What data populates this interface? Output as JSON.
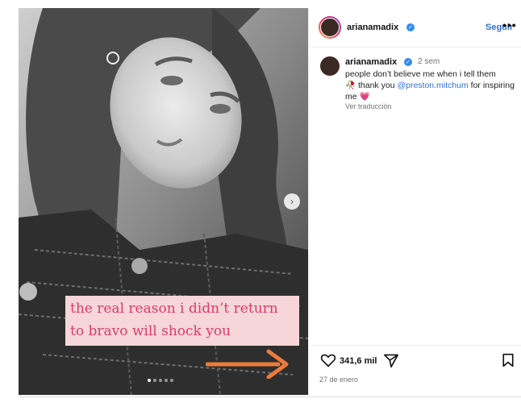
{
  "post": {
    "image": {
      "caption_line1": "the real reason i didn’t return",
      "caption_line2": "to bravo will shock you",
      "caption_color": "#d93b6c",
      "caption_bg": "#f6d6d8",
      "arrow_color": "#ee7a3a",
      "slide_count": 5,
      "active_slide": 1
    },
    "header": {
      "username": "arianamadix",
      "follow_label": "Seguir",
      "more_label": "•••"
    },
    "comment": {
      "username": "arianamadix",
      "time": "2 sem",
      "text_before": "people don’t believe me when i tell them",
      "rose_emoji": "🥀",
      "text_thanks": " thank you ",
      "mention": "@preston.mitchum",
      "text_after": " for inspiring me ",
      "heart_emoji": "💗",
      "translate_label": "Ver traducción"
    },
    "actions": {
      "likes": "341,6 mil",
      "date": "27 de enero"
    }
  }
}
